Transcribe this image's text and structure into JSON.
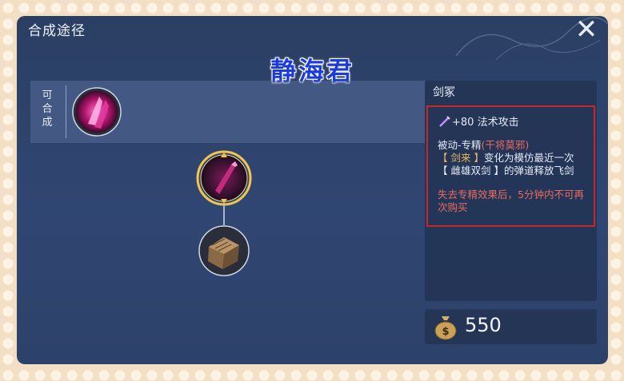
{
  "window": {
    "title": "合成途径",
    "watermark": "静海君",
    "close_icon": "close-x-icon"
  },
  "craft_panel": {
    "label_chars": [
      "可",
      "合",
      "成"
    ],
    "item_icon": "crimson-crystal-item-icon"
  },
  "build_tree": {
    "top_item_icon": "crimson-sword-item-icon",
    "bottom_item_icon": "wooden-crate-item-icon",
    "top_selected_ring_color": "#f3c64b"
  },
  "item_info": {
    "name": "剑冢",
    "stat_text": "+80 法术攻击",
    "stat_icon": "magic-wand-icon",
    "passive_title": "被动-专精",
    "passive_tag": "(干将莫邪)",
    "passive_line2_tag": "【 剑来 】",
    "passive_line2_text": "变化为模仿最近一次",
    "passive_line3": "【 雌雄双剑 】的弹道释放飞剑",
    "warning": "失去专精效果后，5分钟内不可再次购买",
    "highlight_border_color": "#c8262a"
  },
  "price": {
    "value": "550",
    "icon": "money-bag-icon"
  }
}
